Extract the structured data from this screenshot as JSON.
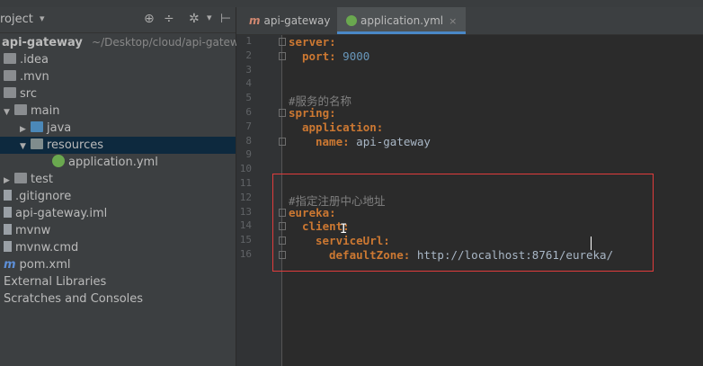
{
  "project_panel": {
    "title": "roject",
    "tree": [
      {
        "label": "api-gateway",
        "suffix": "~/Desktop/cloud/api-gatew",
        "kind": "module",
        "bold": true
      },
      {
        "label": ".idea",
        "kind": "folder"
      },
      {
        "label": ".mvn",
        "kind": "folder"
      },
      {
        "label": "src",
        "kind": "folder"
      },
      {
        "label": "main",
        "kind": "folder",
        "expanded": true
      },
      {
        "label": "java",
        "kind": "folder-blue"
      },
      {
        "label": "resources",
        "kind": "folder-res",
        "expanded": true,
        "selected": true
      },
      {
        "label": "application.yml",
        "kind": "spring-file"
      },
      {
        "label": "test",
        "kind": "folder"
      },
      {
        "label": ".gitignore",
        "kind": "file"
      },
      {
        "label": "api-gateway.iml",
        "kind": "file"
      },
      {
        "label": "mvnw",
        "kind": "file"
      },
      {
        "label": "mvnw.cmd",
        "kind": "file"
      },
      {
        "label": "pom.xml",
        "kind": "maven-file"
      },
      {
        "label": "External Libraries",
        "kind": "node"
      },
      {
        "label": "Scratches and Consoles",
        "kind": "node"
      }
    ]
  },
  "tabs": [
    {
      "label": "api-gateway",
      "icon": "m-icon",
      "active": false
    },
    {
      "label": "application.yml",
      "icon": "spring-leaf-icon",
      "active": true
    }
  ],
  "editor": {
    "line_numbers": [
      "1",
      "2",
      "3",
      "4",
      "5",
      "6",
      "7",
      "8",
      "9",
      "10",
      "11",
      "12",
      "13",
      "14",
      "15",
      "16"
    ],
    "lines": [
      {
        "indent": "",
        "key": "server",
        "sep": ":",
        "value": "",
        "comment": ""
      },
      {
        "indent": "  ",
        "key": "port",
        "sep": ": ",
        "value": "9000",
        "comment": ""
      },
      {
        "indent": "",
        "key": "",
        "sep": "",
        "value": "",
        "comment": ""
      },
      {
        "indent": "",
        "key": "",
        "sep": "",
        "value": "",
        "comment": ""
      },
      {
        "indent": "",
        "key": "",
        "sep": "",
        "value": "",
        "comment": "#服务的名称"
      },
      {
        "indent": "",
        "key": "spring",
        "sep": ":",
        "value": "",
        "comment": ""
      },
      {
        "indent": "  ",
        "key": "application",
        "sep": ":",
        "value": "",
        "comment": ""
      },
      {
        "indent": "    ",
        "key": "name",
        "sep": ": ",
        "value": "api-gateway",
        "comment": ""
      },
      {
        "indent": "",
        "key": "",
        "sep": "",
        "value": "",
        "comment": ""
      },
      {
        "indent": "",
        "key": "",
        "sep": "",
        "value": "",
        "comment": ""
      },
      {
        "indent": "",
        "key": "",
        "sep": "",
        "value": "",
        "comment": ""
      },
      {
        "indent": "",
        "key": "",
        "sep": "",
        "value": "",
        "comment": "#指定注册中心地址"
      },
      {
        "indent": "",
        "key": "eureka",
        "sep": ":",
        "value": "",
        "comment": ""
      },
      {
        "indent": "  ",
        "key": "client",
        "sep": ":",
        "value": "",
        "comment": ""
      },
      {
        "indent": "    ",
        "key": "serviceUrl",
        "sep": ":",
        "value": "",
        "comment": ""
      },
      {
        "indent": "      ",
        "key": "defaultZone",
        "sep": ": ",
        "value": "http://localhost:8761/eureka/",
        "comment": ""
      }
    ]
  },
  "colors": {
    "key": "#cc7832",
    "string": "#a9b7c6",
    "number": "#6897bb",
    "comment": "#808080",
    "highlight_box": "#e03c3c",
    "selection": "#0d293e"
  }
}
